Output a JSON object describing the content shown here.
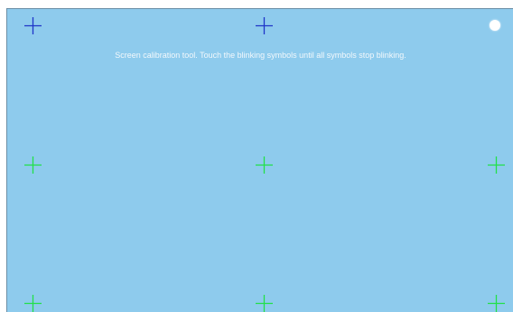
{
  "calibration": {
    "instruction": "Screen calibration tool. Touch the blinking symbols until all symbols stop blinking."
  },
  "targets": [
    {
      "name": "top-left",
      "state": "pending",
      "color": "#1f36c8"
    },
    {
      "name": "top-center",
      "state": "pending",
      "color": "#1f36c8"
    },
    {
      "name": "top-right",
      "state": "active",
      "color": "#ffffff"
    },
    {
      "name": "middle-left",
      "state": "done",
      "color": "#22e04a"
    },
    {
      "name": "middle-center",
      "state": "done",
      "color": "#22e04a"
    },
    {
      "name": "middle-right",
      "state": "done",
      "color": "#22e04a"
    },
    {
      "name": "bottom-left",
      "state": "done",
      "color": "#22e04a"
    },
    {
      "name": "bottom-center",
      "state": "done",
      "color": "#22e04a"
    },
    {
      "name": "bottom-right",
      "state": "done",
      "color": "#22e04a"
    }
  ],
  "colors": {
    "background": "#8ecbed",
    "text": "#f2f8fc"
  }
}
